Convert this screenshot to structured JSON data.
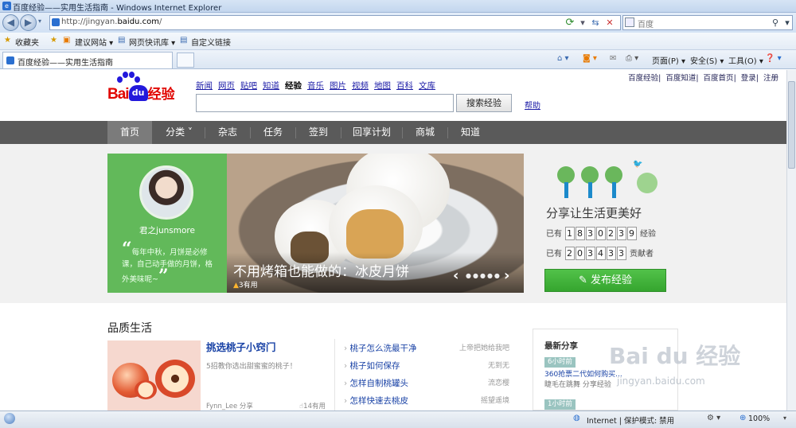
{
  "window": {
    "title": "百度经验——实用生活指南 - Windows Internet Explorer",
    "address": "http://jingyan.baidu.com/",
    "address_prefix": "http://jingyan.",
    "address_domain": "baidu.com",
    "address_suffix": "/",
    "search_placeholder": "百度"
  },
  "favorites": {
    "label": "收藏夹",
    "items": [
      "建议网站 ▾",
      "网页快讯库 ▾",
      "自定义链接"
    ]
  },
  "tab": {
    "title": "百度经验——实用生活指南"
  },
  "commands": [
    "页面(P) ▾",
    "安全(S) ▾",
    "工具(O) ▾",
    "❓ ▾"
  ],
  "toplinks": [
    "百度经验",
    "百度知道",
    "百度首页",
    "登录",
    "注册"
  ],
  "logo": {
    "bai": "Bai",
    "du": "du",
    "jingyan": "经验"
  },
  "top_nav": [
    "新闻",
    "网页",
    "贴吧",
    "知道",
    "经验",
    "音乐",
    "图片",
    "视频",
    "地图",
    "百科",
    "文库"
  ],
  "top_nav_active": "经验",
  "search": {
    "button": "搜索经验",
    "help": "帮助",
    "value": ""
  },
  "main_nav": [
    "首页",
    "分类 ˅",
    "杂志",
    "任务",
    "签到",
    "回享计划",
    "商城",
    "知道"
  ],
  "feature": {
    "author": "君之junsmore",
    "quote": "每年中秋，月饼是必修课，自己动手做的月饼，格外美味呢~",
    "title": "不用烤箱也能做的：冰皮月饼",
    "useful": "3有用",
    "prev": "‹",
    "next": "›",
    "dots": "●●●●●"
  },
  "stats": {
    "slogan": "分享让生活更美好",
    "have1": "已有",
    "count1": [
      "1",
      "8",
      "3",
      "0",
      "2",
      "3",
      "9"
    ],
    "unit1": "经验",
    "have2": "已有",
    "count2": [
      "2",
      "0",
      "3",
      "4",
      "3",
      "3"
    ],
    "unit2": "贡献者",
    "publish": "发布经验"
  },
  "quality": {
    "heading": "品质生活",
    "featured_title": "挑选桃子小窍门",
    "featured_desc": "5招教你选出甜蜜蜜的桃子！",
    "featured_author": "Fynn_Lee",
    "featured_share": "分享",
    "featured_useful": "14有用",
    "list": [
      {
        "title": "桃子怎么洗最干净",
        "author": "上帝把她给我吧"
      },
      {
        "title": "桃子如何保存",
        "author": "无到无"
      },
      {
        "title": "怎样自制桃罐头",
        "author": "流恋樱"
      },
      {
        "title": "怎样快速去桃皮",
        "author": "摇望遥境"
      }
    ]
  },
  "latest": {
    "title": "最新分享",
    "tag1": "6小时前",
    "line1": "360抢票二代如何购买...",
    "line2": "睫毛在跳舞 分享经验",
    "tag2": "1小时前"
  },
  "watermark": {
    "text": "Bai du 经验",
    "url": "jingyan.baidu.com"
  },
  "statusbar": {
    "zone": "Internet | 保护模式: 禁用",
    "zoom": "100%"
  }
}
